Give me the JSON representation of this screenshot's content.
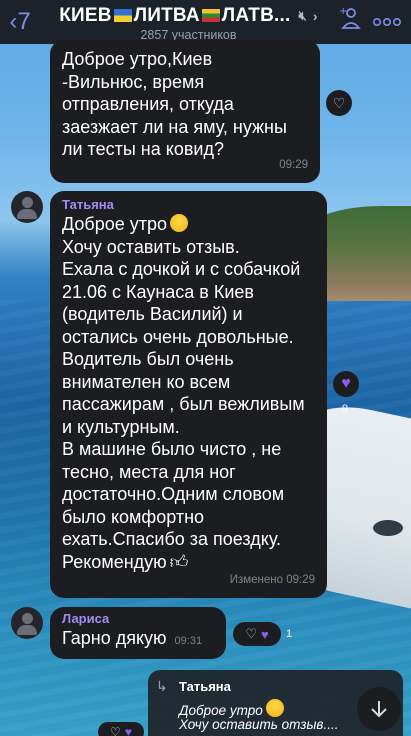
{
  "header": {
    "back_icon": "back-chevron-icon",
    "title_part1": "КИЕВ",
    "title_part2": "ЛИТВА",
    "title_part3": "ЛАТВ...",
    "muted_icon": "mute-icon",
    "subtitle": "2857 участников",
    "add_user_icon": "add-user-icon",
    "more_icon": "more-icon"
  },
  "messages": [
    {
      "sender": "",
      "text": "Доброе утро,Киев\n-Вильнюс, время\nотправления, откуда\nзаезжает ли на яму, нужны\nли тесты на ковид?",
      "time": "09:29"
    },
    {
      "sender": "Татьяна",
      "text_first": "Доброе утро",
      "text": "Хочу оставить отзыв.\nЕхала с дочкой и с собачкой\n21.06 с Каунаса в Киев\n(водитель Василий) и\nостались очень довольные.\nВодитель был очень\nвнимателен ко всем\nпассажирам , был вежливым\nи культурным.\nВ машине было чисто , не\nтесно, места для ног\nдостаточно.Одним словом\nбыло  комфортно\nехать.Спасибо за поездку.",
      "text_last": "Рекомендую",
      "time": "Изменено  09:29",
      "reaction_count": "9"
    },
    {
      "sender": "Лариса",
      "text": "Гарно дякую",
      "time": "09:31",
      "reaction_count": "1"
    }
  ],
  "reply": {
    "name": "Татьяна",
    "line1": "Доброе утро",
    "line2": "Хочу оставить отзыв...."
  },
  "colors": {
    "accent": "#7d8ee8",
    "sender_name": "#a38ef0",
    "bubble_bg": "#1c1d21",
    "heart_purple": "#8a5cf0"
  }
}
